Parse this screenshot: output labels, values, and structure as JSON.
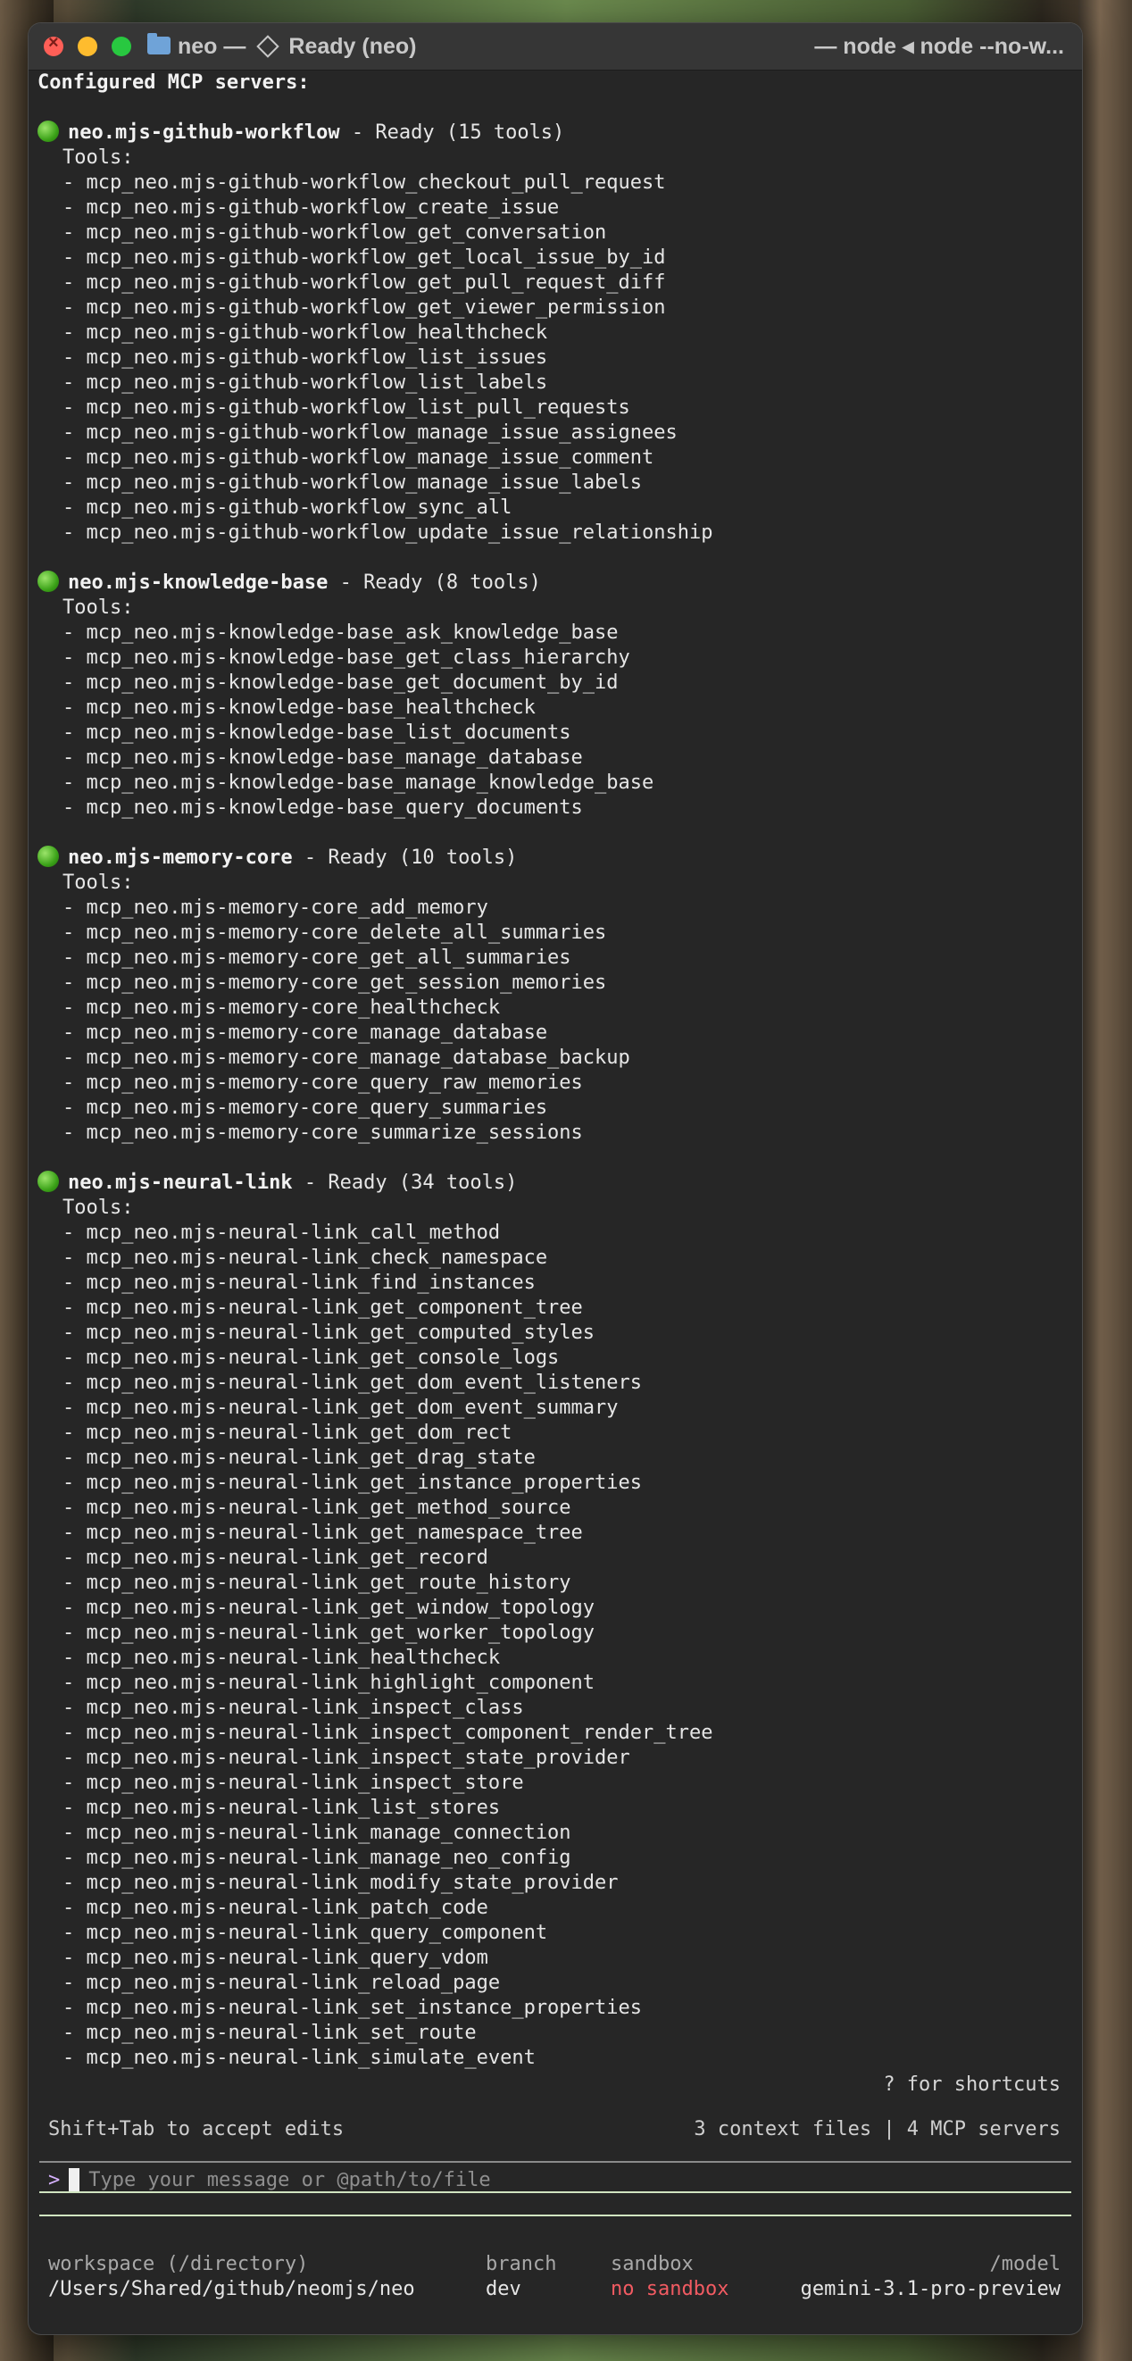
{
  "window": {
    "title_left": "neo — ",
    "title_status": "Ready (neo)",
    "title_right": "— node ◂ node --no-w..."
  },
  "terminal": {
    "header": "Configured MCP servers:",
    "tools_label": "Tools:",
    "servers": [
      {
        "name": "neo.mjs-github-workflow",
        "status": " - Ready (15 tools)",
        "tools": [
          "mcp_neo.mjs-github-workflow_checkout_pull_request",
          "mcp_neo.mjs-github-workflow_create_issue",
          "mcp_neo.mjs-github-workflow_get_conversation",
          "mcp_neo.mjs-github-workflow_get_local_issue_by_id",
          "mcp_neo.mjs-github-workflow_get_pull_request_diff",
          "mcp_neo.mjs-github-workflow_get_viewer_permission",
          "mcp_neo.mjs-github-workflow_healthcheck",
          "mcp_neo.mjs-github-workflow_list_issues",
          "mcp_neo.mjs-github-workflow_list_labels",
          "mcp_neo.mjs-github-workflow_list_pull_requests",
          "mcp_neo.mjs-github-workflow_manage_issue_assignees",
          "mcp_neo.mjs-github-workflow_manage_issue_comment",
          "mcp_neo.mjs-github-workflow_manage_issue_labels",
          "mcp_neo.mjs-github-workflow_sync_all",
          "mcp_neo.mjs-github-workflow_update_issue_relationship"
        ]
      },
      {
        "name": "neo.mjs-knowledge-base",
        "status": " - Ready (8 tools)",
        "tools": [
          "mcp_neo.mjs-knowledge-base_ask_knowledge_base",
          "mcp_neo.mjs-knowledge-base_get_class_hierarchy",
          "mcp_neo.mjs-knowledge-base_get_document_by_id",
          "mcp_neo.mjs-knowledge-base_healthcheck",
          "mcp_neo.mjs-knowledge-base_list_documents",
          "mcp_neo.mjs-knowledge-base_manage_database",
          "mcp_neo.mjs-knowledge-base_manage_knowledge_base",
          "mcp_neo.mjs-knowledge-base_query_documents"
        ]
      },
      {
        "name": "neo.mjs-memory-core",
        "status": " - Ready (10 tools)",
        "tools": [
          "mcp_neo.mjs-memory-core_add_memory",
          "mcp_neo.mjs-memory-core_delete_all_summaries",
          "mcp_neo.mjs-memory-core_get_all_summaries",
          "mcp_neo.mjs-memory-core_get_session_memories",
          "mcp_neo.mjs-memory-core_healthcheck",
          "mcp_neo.mjs-memory-core_manage_database",
          "mcp_neo.mjs-memory-core_manage_database_backup",
          "mcp_neo.mjs-memory-core_query_raw_memories",
          "mcp_neo.mjs-memory-core_query_summaries",
          "mcp_neo.mjs-memory-core_summarize_sessions"
        ]
      },
      {
        "name": "neo.mjs-neural-link",
        "status": " - Ready (34 tools)",
        "tools": [
          "mcp_neo.mjs-neural-link_call_method",
          "mcp_neo.mjs-neural-link_check_namespace",
          "mcp_neo.mjs-neural-link_find_instances",
          "mcp_neo.mjs-neural-link_get_component_tree",
          "mcp_neo.mjs-neural-link_get_computed_styles",
          "mcp_neo.mjs-neural-link_get_console_logs",
          "mcp_neo.mjs-neural-link_get_dom_event_listeners",
          "mcp_neo.mjs-neural-link_get_dom_event_summary",
          "mcp_neo.mjs-neural-link_get_dom_rect",
          "mcp_neo.mjs-neural-link_get_drag_state",
          "mcp_neo.mjs-neural-link_get_instance_properties",
          "mcp_neo.mjs-neural-link_get_method_source",
          "mcp_neo.mjs-neural-link_get_namespace_tree",
          "mcp_neo.mjs-neural-link_get_record",
          "mcp_neo.mjs-neural-link_get_route_history",
          "mcp_neo.mjs-neural-link_get_window_topology",
          "mcp_neo.mjs-neural-link_get_worker_topology",
          "mcp_neo.mjs-neural-link_healthcheck",
          "mcp_neo.mjs-neural-link_highlight_component",
          "mcp_neo.mjs-neural-link_inspect_class",
          "mcp_neo.mjs-neural-link_inspect_component_render_tree",
          "mcp_neo.mjs-neural-link_inspect_state_provider",
          "mcp_neo.mjs-neural-link_inspect_store",
          "mcp_neo.mjs-neural-link_list_stores",
          "mcp_neo.mjs-neural-link_manage_connection",
          "mcp_neo.mjs-neural-link_manage_neo_config",
          "mcp_neo.mjs-neural-link_modify_state_provider",
          "mcp_neo.mjs-neural-link_patch_code",
          "mcp_neo.mjs-neural-link_query_component",
          "mcp_neo.mjs-neural-link_query_vdom",
          "mcp_neo.mjs-neural-link_reload_page",
          "mcp_neo.mjs-neural-link_set_instance_properties",
          "mcp_neo.mjs-neural-link_set_route",
          "mcp_neo.mjs-neural-link_simulate_event"
        ]
      }
    ]
  },
  "hint": {
    "shortcuts": "? for shortcuts"
  },
  "status": {
    "left": "Shift+Tab to accept edits",
    "right": "3 context files | 4 MCP servers"
  },
  "input": {
    "prompt": ">",
    "placeholder": "Type your message or @path/to/file"
  },
  "footer": {
    "workspace_label": "workspace (/directory)",
    "workspace_value": "/Users/Shared/github/neomjs/neo",
    "branch_label": "branch",
    "branch_value": "dev",
    "sandbox_label": "sandbox",
    "sandbox_value": "no sandbox",
    "model_label": "/model",
    "model_value": "gemini-3.1-pro-preview"
  }
}
